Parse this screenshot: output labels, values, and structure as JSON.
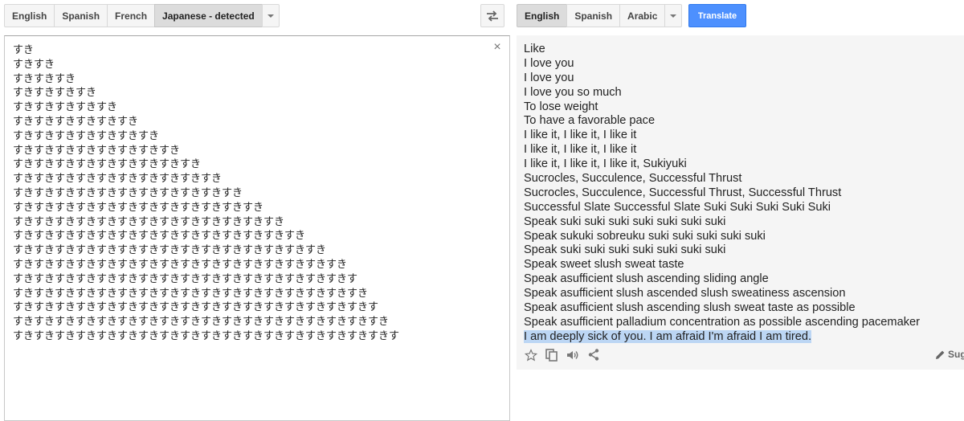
{
  "source_langs": {
    "items": [
      {
        "label": "English"
      },
      {
        "label": "Spanish"
      },
      {
        "label": "French"
      },
      {
        "label": "Japanese - detected"
      }
    ]
  },
  "target_langs": {
    "items": [
      {
        "label": "English"
      },
      {
        "label": "Spanish"
      },
      {
        "label": "Arabic"
      }
    ]
  },
  "translate_label": "Translate",
  "clear_icon_glyph": "×",
  "source_lines": [
    "すき",
    "すきすき",
    "すきすきすき",
    "すきすきすきすき",
    "すきすきすきすきすき",
    "すきすきすきすきすきすき",
    "すきすきすきすきすきすきすき",
    "すきすきすきすきすきすきすきすき",
    "すきすきすきすきすきすきすきすきすき",
    "すきすきすきすきすきすきすきすきすきすき",
    "すきすきすきすきすきすきすきすきすきすきすき",
    "すきすきすきすきすきすきすきすきすきすきすきすき",
    "すきすきすきすきすきすきすきすきすきすきすきすきすき",
    "すきすきすきすきすきすきすきすきすきすきすきすきすきすき",
    "すきすきすきすきすきすきすきすきすきすきすきすきすきすきすき",
    "すきすきすきすきすきすきすきすきすきすきすきすきすきすきすきすき",
    "すきすきすきすきすきすきすきすきすきすきすきすきすきすきすきすきす",
    "すきすきすきすきすきすきすきすきすきすきすきすきすきすきすきすきすき",
    "すきすきすきすきすきすきすきすきすきすきすきすきすきすきすきすきすきす",
    "すきすきすきすきすきすきすきすきすきすきすきすきすきすきすきすきすきすき",
    "すきすきすきすきすきすきすきすきすきすきすきすきすきすきすきすきすきすきす"
  ],
  "result_lines": [
    "Like",
    "I love you",
    "I love you",
    "I love you so much",
    "To lose weight",
    "To have a favorable pace",
    "I like it, I like it, I like it",
    "I like it, I like it, I like it",
    "I like it, I like it, I like it, Sukiyuki",
    "Sucrocles, Succulence, Successful Thrust",
    "Sucrocles, Succulence, Successful Thrust, Successful Thrust",
    "Successful Slate Successful Slate Suki Suki Suki Suki Suki",
    "Speak suki suki suki suki suki suki suki",
    "Speak sukuki sobreuku suki suki suki suki suki",
    "Speak suki suki suki suki suki suki suki",
    "Speak sweet slush sweat taste",
    "Speak asufficient slush ascending sliding angle",
    "Speak asufficient slush ascended slush sweatiness ascension",
    "Speak asufficient slush ascending slush sweat taste as possible",
    "Speak asufficient palladium concentration as possible ascending pacemaker"
  ],
  "highlighted_line": "I am deeply sick of you. I am afraid I'm afraid I am tired.",
  "suggest_label": "Sug",
  "icons": [
    "swap-icon",
    "close-icon",
    "star-icon",
    "copy-icon",
    "speaker-icon",
    "share-icon",
    "pencil-icon",
    "chevron-down-icon"
  ],
  "colors": {
    "translate_button": "#4d90fe",
    "highlight": "#bcd6f4",
    "result_bg": "#f5f5f5"
  }
}
